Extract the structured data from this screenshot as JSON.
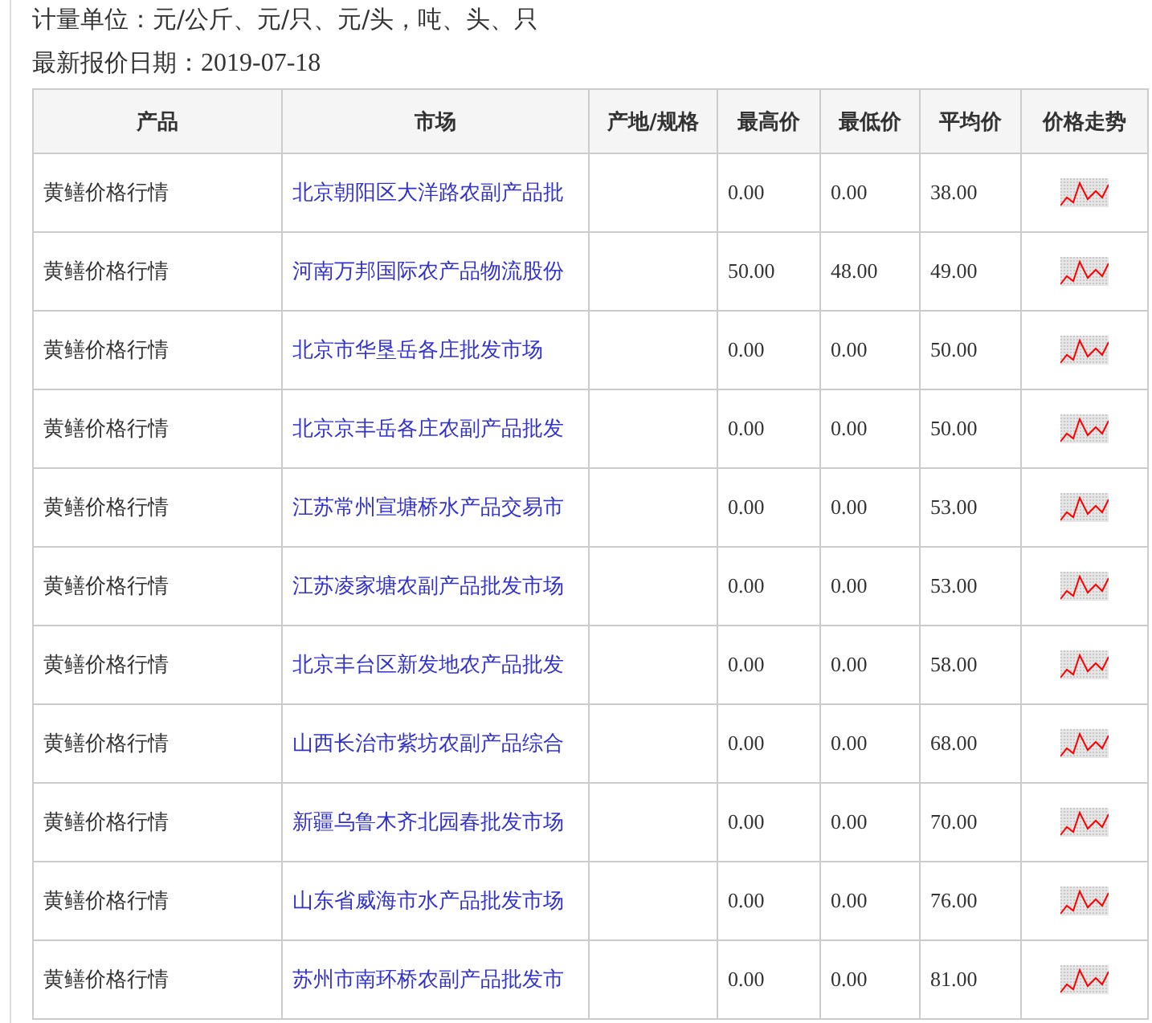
{
  "unit_line": "计量单位：元/公斤、元/只、元/头，吨、头、只",
  "date_line": {
    "label": "最新报价日期：",
    "value": "2019-07-18"
  },
  "table": {
    "columns": [
      "产品",
      "市场",
      "产地/规格",
      "最高价",
      "最低价",
      "平均价",
      "价格走势"
    ],
    "rows": [
      {
        "product": "黄鳝价格行情",
        "market": "北京朝阳区大洋路农副产品批",
        "high": "0.00",
        "low": "0.00",
        "avg": "38.00"
      },
      {
        "product": "黄鳝价格行情",
        "market": "河南万邦国际农产品物流股份",
        "high": "50.00",
        "low": "48.00",
        "avg": "49.00"
      },
      {
        "product": "黄鳝价格行情",
        "market": "北京市华垦岳各庄批发市场",
        "high": "0.00",
        "low": "0.00",
        "avg": "50.00"
      },
      {
        "product": "黄鳝价格行情",
        "market": "北京京丰岳各庄农副产品批发",
        "high": "0.00",
        "low": "0.00",
        "avg": "50.00"
      },
      {
        "product": "黄鳝价格行情",
        "market": "江苏常州宣塘桥水产品交易市",
        "high": "0.00",
        "low": "0.00",
        "avg": "53.00"
      },
      {
        "product": "黄鳝价格行情",
        "market": "江苏凌家塘农副产品批发市场",
        "high": "0.00",
        "low": "0.00",
        "avg": "53.00"
      },
      {
        "product": "黄鳝价格行情",
        "market": "北京丰台区新发地农产品批发",
        "high": "0.00",
        "low": "0.00",
        "avg": "58.00"
      },
      {
        "product": "黄鳝价格行情",
        "market": "山西长治市紫坊农副产品综合",
        "high": "0.00",
        "low": "0.00",
        "avg": "68.00"
      },
      {
        "product": "黄鳝价格行情",
        "market": "新疆乌鲁木齐北园春批发市场",
        "high": "0.00",
        "low": "0.00",
        "avg": "70.00"
      },
      {
        "product": "黄鳝价格行情",
        "market": "山东省威海市水产品批发市场",
        "high": "0.00",
        "low": "0.00",
        "avg": "76.00"
      },
      {
        "product": "黄鳝价格行情",
        "market": "苏州市南环桥农副产品批发市",
        "high": "0.00",
        "low": "0.00",
        "avg": "81.00"
      }
    ]
  }
}
